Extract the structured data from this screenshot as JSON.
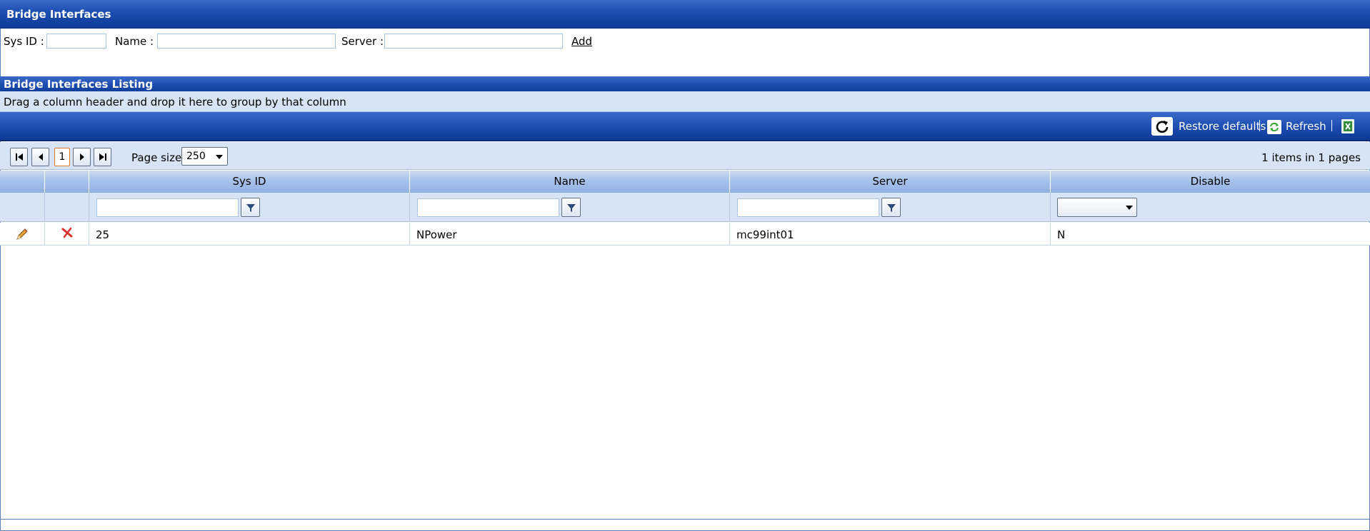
{
  "page": {
    "title": "Bridge Interfaces"
  },
  "form": {
    "sys_id_label": "Sys ID :",
    "sys_id_value": "",
    "name_label": "Name :",
    "name_value": "",
    "server_label": "Server :",
    "server_value": "",
    "add_label": "Add"
  },
  "listing": {
    "title": "Bridge Interfaces Listing",
    "group_hint": "Drag a column header and drop it here to group by that column"
  },
  "toolbar": {
    "restore_label": "Restore defaults",
    "refresh_label": "Refresh",
    "icons": [
      "reload-icon",
      "refresh-icon",
      "export-excel-icon"
    ]
  },
  "pager": {
    "current_page": "1",
    "page_size_label": "Page size:",
    "page_size_value": "250",
    "items_info": "1 items in 1 pages"
  },
  "grid": {
    "columns": [
      "Sys ID",
      "Name",
      "Server",
      "Disable"
    ],
    "filters": {
      "sys_id": "",
      "name": "",
      "server": "",
      "disable": ""
    },
    "rows": [
      {
        "sys_id": "25",
        "name": "NPower",
        "server": "mc99int01",
        "disable": "N"
      }
    ]
  },
  "colors": {
    "header_blue": "#1e4fb3",
    "panel_light": "#d6e4f5",
    "grid_header": "#a8c2ea",
    "delete_red": "#d9302c"
  }
}
